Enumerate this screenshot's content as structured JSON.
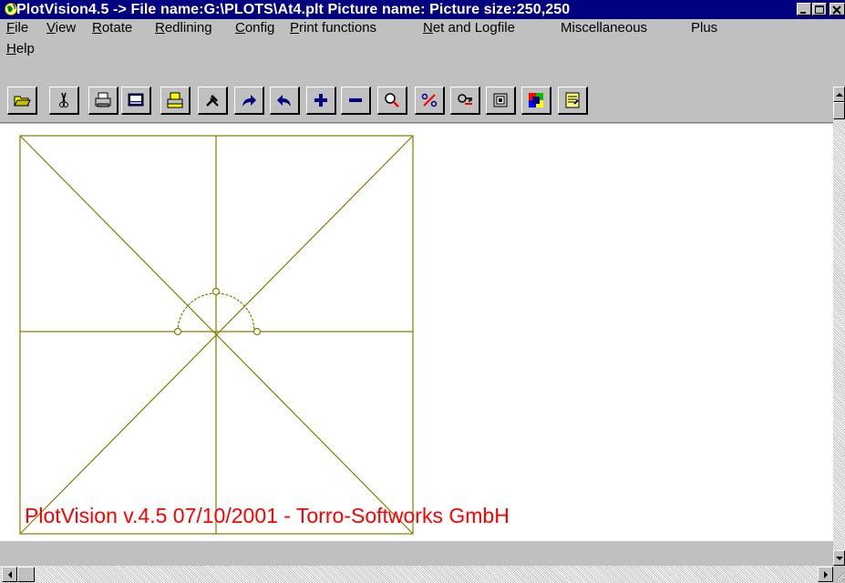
{
  "window": {
    "title": "PlotVision4.5 -> File name:G:\\PLOTS\\At4.plt Picture name: Picture size:250,250",
    "title_bar_color": "#000080"
  },
  "menu": {
    "items": [
      {
        "mnemonic": "F",
        "rest": "ile"
      },
      {
        "mnemonic": "V",
        "rest": "iew"
      },
      {
        "mnemonic": "R",
        "rest": "otate"
      },
      {
        "mnemonic": "R",
        "rest": "edlining"
      },
      {
        "mnemonic": "C",
        "rest": "onfig"
      },
      {
        "mnemonic": "P",
        "rest": "rint functions"
      },
      {
        "mnemonic": "N",
        "rest": "et and Logfile"
      },
      {
        "mnemonic": "",
        "rest": "Miscellaneous"
      },
      {
        "mnemonic": "",
        "rest": "Plus"
      },
      {
        "mnemonic": "H",
        "rest": "elp"
      }
    ]
  },
  "toolbar": {
    "buttons": [
      {
        "icon": "open-folder-icon"
      },
      {
        "icon": "scissors-icon"
      },
      {
        "icon": "printer-icon"
      },
      {
        "icon": "print-preview-icon"
      },
      {
        "icon": "plotter-icon"
      },
      {
        "icon": "tools-icon"
      },
      {
        "icon": "redo-arrow-icon"
      },
      {
        "icon": "undo-arrow-icon"
      },
      {
        "icon": "zoom-in-plus-icon"
      },
      {
        "icon": "zoom-out-minus-icon"
      },
      {
        "icon": "zoom-window-icon"
      },
      {
        "icon": "percent-icon"
      },
      {
        "icon": "search-key-icon"
      },
      {
        "icon": "layers-icon"
      },
      {
        "icon": "color-palette-icon"
      },
      {
        "icon": "notes-icon"
      }
    ]
  },
  "drawing": {
    "line_color": "#808000",
    "text_color": "#ff0000",
    "caption": "PlotVision v.4.5 07/10/2001 - Torro-Softworks GmbH"
  }
}
